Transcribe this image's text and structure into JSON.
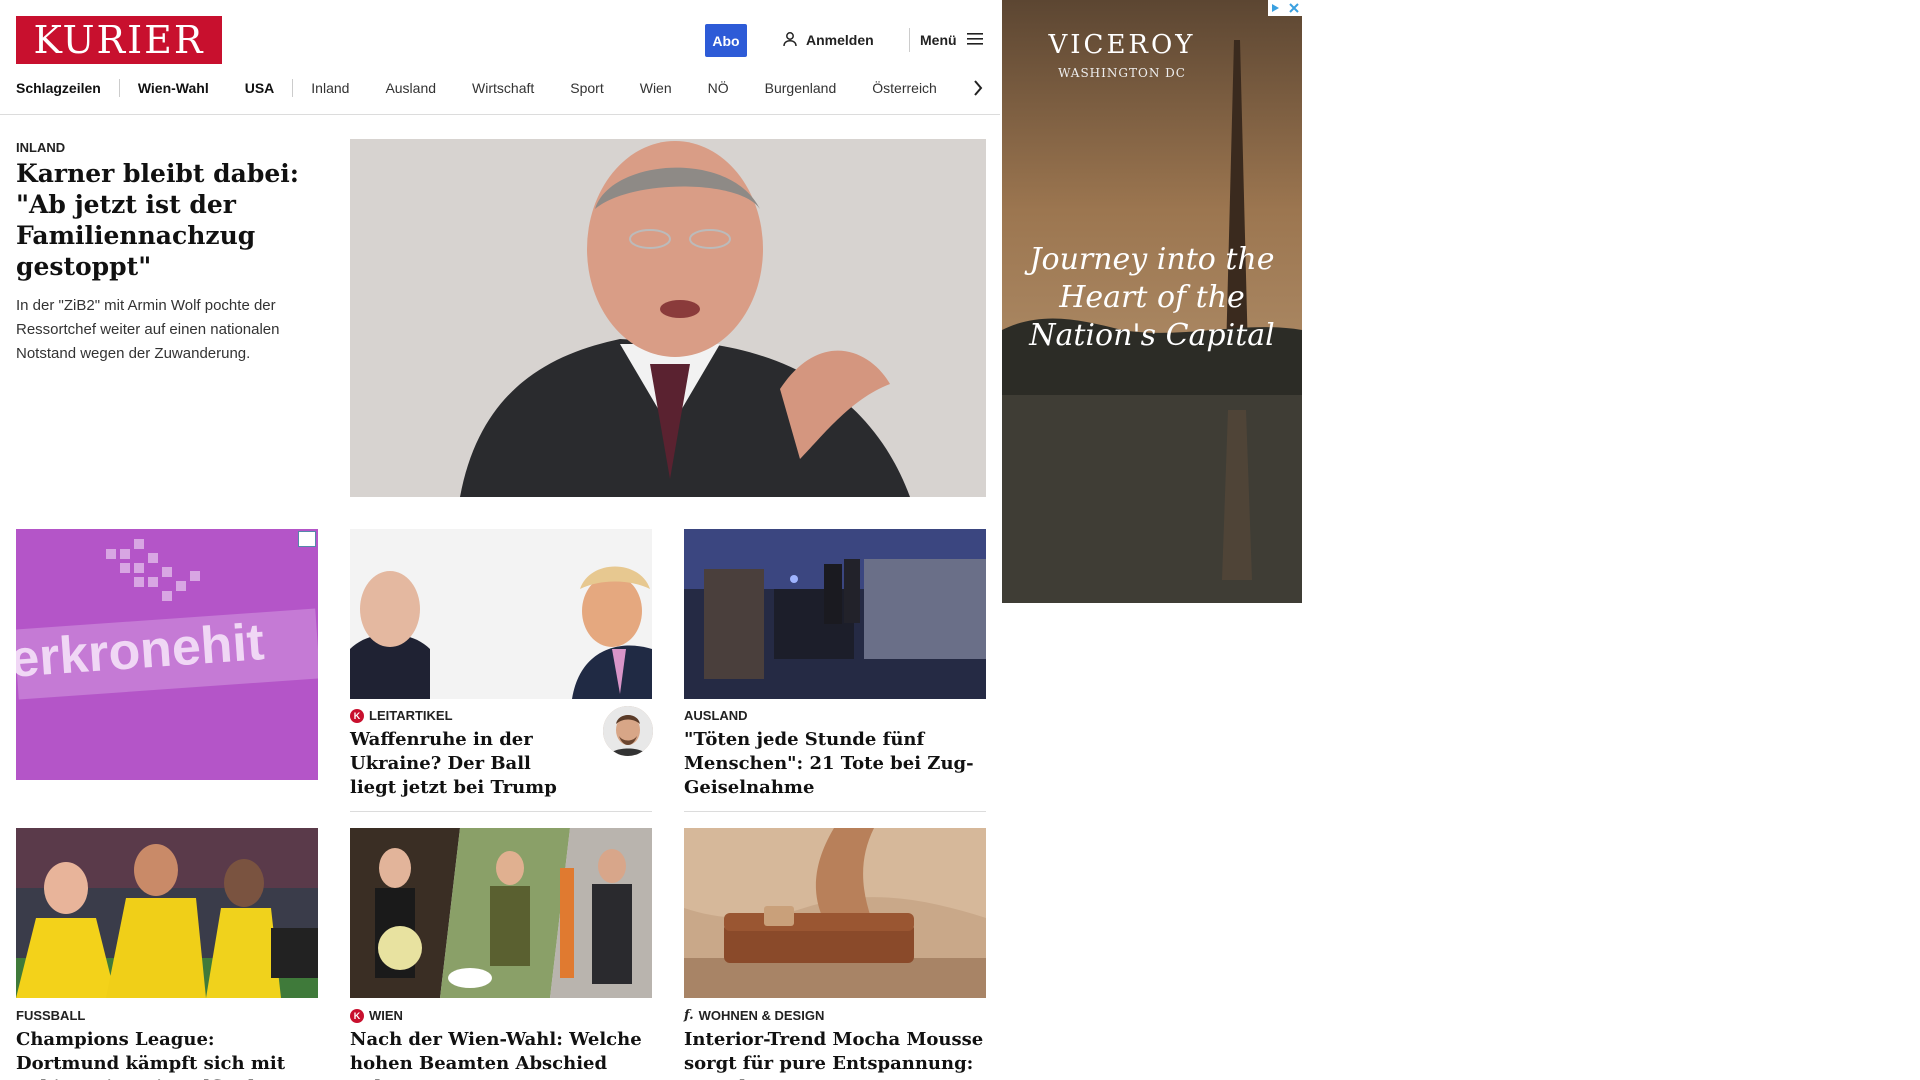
{
  "header": {
    "logo": "KURIER",
    "abo_label": "Abo",
    "login_label": "Anmelden",
    "menu_label": "Menü"
  },
  "nav": {
    "items": [
      "Schlagzeilen",
      "Wien-Wahl",
      "USA",
      "Inland",
      "Ausland",
      "Wirtschaft",
      "Sport",
      "Wien",
      "NÖ",
      "Burgenland",
      "Österreich"
    ]
  },
  "lead": {
    "category": "INLAND",
    "title": "Karner bleibt dabei: \"Ab jetzt ist der Familiennachzug gestoppt\"",
    "teaser": "In der \"ZiB2\" mit Armin Wolf pochte der Ressortchef weiter auf einen nationalen Notstand wegen der Zuwanderung."
  },
  "cards": [
    {
      "category": "LEITARTIKEL",
      "title": "Waffenruhe in der Ukraine? Der Ball liegt jetzt bei Trump"
    },
    {
      "category": "AUSLAND",
      "title": "\"Töten jede Stunde fünf Menschen\": 21 Tote bei Zug-Geiselnahme"
    },
    {
      "category": "FUSSBALL",
      "title": "Champions League: Dortmund kämpft sich mit Sabitzer ins Viertelfinale"
    },
    {
      "category": "WIEN",
      "title": "Nach der Wien-Wahl: Welche hohen Beamten Abschied nehmen"
    },
    {
      "category": "WOHNEN & DESIGN",
      "title": "Interior-Trend Mocha Mousse sorgt für pure Entspannung: So geht's"
    }
  ],
  "ads": {
    "left_text": "erkronehit",
    "right_brand": "VICEROY",
    "right_location": "WASHINGTON DC",
    "right_tagline_1": "Journey into the",
    "right_tagline_2": "Heart of the",
    "right_tagline_3": "Nation's Capital"
  },
  "icons": {
    "user": "user-icon",
    "menu": "hamburger-icon",
    "arrow": "chevron-right-icon",
    "badge": "kurier-k-badge-icon",
    "design": "design-brand-icon"
  },
  "colors": {
    "brand": "#c8102e",
    "abo": "#2d5bd7",
    "ad_left": "#b455c8"
  }
}
